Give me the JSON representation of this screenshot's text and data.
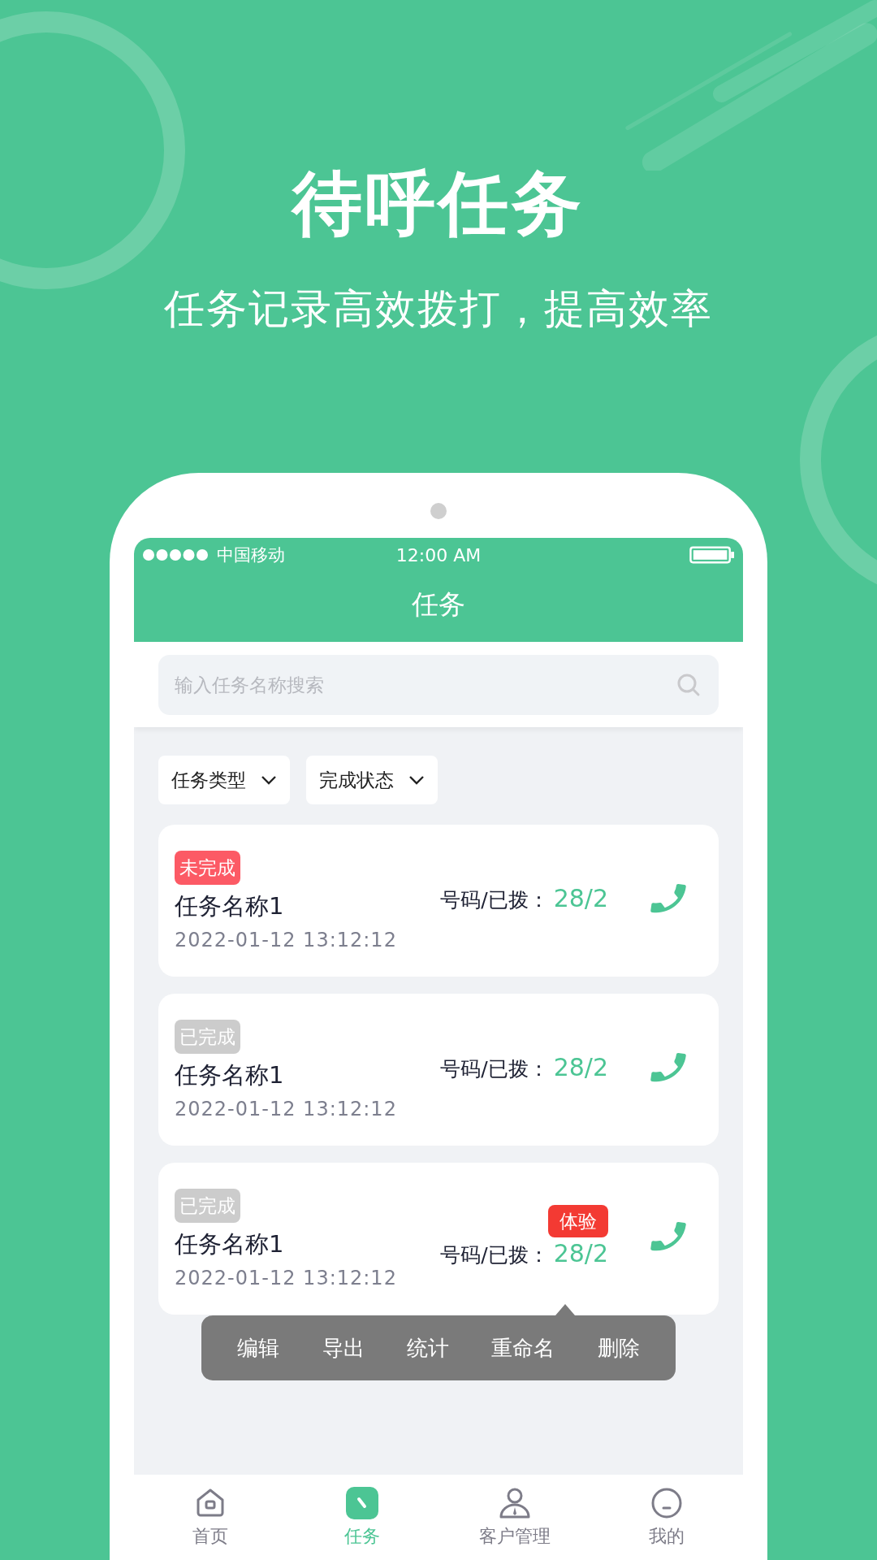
{
  "hero": {
    "title": "待呼任务",
    "subtitle": "任务记录高效拨打，提高效率"
  },
  "status_bar": {
    "carrier": "中国移动",
    "time": "12:00 AM"
  },
  "header": {
    "title": "任务"
  },
  "search": {
    "placeholder": "输入任务名称搜索"
  },
  "filters": [
    {
      "label": "任务类型"
    },
    {
      "label": "完成状态"
    }
  ],
  "tasks": [
    {
      "status": {
        "text": "未完成",
        "kind": "pending"
      },
      "name": "任务名称1",
      "count_label": "号码/已拨：",
      "count": "28/2",
      "date": "2022-01-12 13:12:12"
    },
    {
      "status": {
        "text": "已完成",
        "kind": "done"
      },
      "name": "任务名称1",
      "count_label": "号码/已拨：",
      "count": "28/2",
      "date": "2022-01-12 13:12:12"
    },
    {
      "status": {
        "text": "已完成",
        "kind": "done"
      },
      "badge": "体验",
      "name": "任务名称1",
      "count_label": "号码/已拨：",
      "count": "28/2",
      "date": "2022-01-12 13:12:12"
    }
  ],
  "action_menu": [
    "编辑",
    "导出",
    "统计",
    "重命名",
    "删除"
  ],
  "tab_bar": [
    {
      "label": "首页",
      "kind": "home",
      "selected": false
    },
    {
      "label": "任务",
      "kind": "task",
      "selected": true
    },
    {
      "label": "客户管理",
      "kind": "customer",
      "selected": false
    },
    {
      "label": "我的",
      "kind": "me",
      "selected": false
    }
  ]
}
